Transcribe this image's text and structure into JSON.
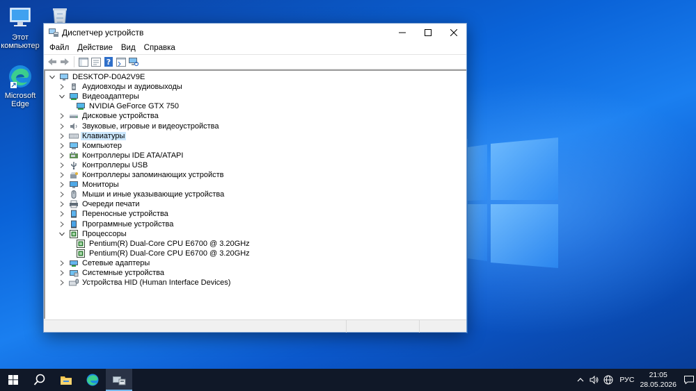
{
  "desktop": {
    "icons": [
      {
        "name": "this-pc",
        "label": "Этот компьютер"
      },
      {
        "name": "recycle-bin",
        "label": ""
      },
      {
        "name": "microsoft-edge",
        "label": "Microsoft Edge"
      }
    ]
  },
  "window": {
    "title": "Диспетчер устройств",
    "menu": [
      "Файл",
      "Действие",
      "Вид",
      "Справка"
    ],
    "toolbar_icons": [
      "back-arrow-icon",
      "forward-arrow-icon",
      "show-hide-console-tree-icon",
      "properties-icon",
      "help-icon",
      "action-pane-icon",
      "scan-hardware-icon"
    ],
    "tree": {
      "root": "DESKTOP-D0A2V9E",
      "items": [
        {
          "label": "Аудиовходы и аудиовыходы",
          "icon": "speaker-icon",
          "expanded": false
        },
        {
          "label": "Видеоадаптеры",
          "icon": "display-adapter-icon",
          "expanded": true,
          "children": [
            {
              "label": "NVIDIA GeForce GTX 750",
              "icon": "display-adapter-icon"
            }
          ]
        },
        {
          "label": "Дисковые устройства",
          "icon": "disk-drive-icon",
          "expanded": false
        },
        {
          "label": "Звуковые, игровые и видеоустройства",
          "icon": "sound-icon",
          "expanded": false
        },
        {
          "label": "Клавиатуры",
          "icon": "keyboard-icon",
          "expanded": false,
          "selected": true
        },
        {
          "label": "Компьютер",
          "icon": "computer-icon",
          "expanded": false
        },
        {
          "label": "Контроллеры IDE ATA/ATAPI",
          "icon": "ide-controller-icon",
          "expanded": false
        },
        {
          "label": "Контроллеры USB",
          "icon": "usb-icon",
          "expanded": false
        },
        {
          "label": "Контроллеры запоминающих устройств",
          "icon": "storage-controller-icon",
          "expanded": false
        },
        {
          "label": "Мониторы",
          "icon": "monitor-icon",
          "expanded": false
        },
        {
          "label": "Мыши и иные указывающие устройства",
          "icon": "mouse-icon",
          "expanded": false
        },
        {
          "label": "Очереди печати",
          "icon": "printer-icon",
          "expanded": false
        },
        {
          "label": "Переносные устройства",
          "icon": "portable-device-icon",
          "expanded": false
        },
        {
          "label": "Программные устройства",
          "icon": "software-device-icon",
          "expanded": false
        },
        {
          "label": "Процессоры",
          "icon": "processor-icon",
          "expanded": true,
          "children": [
            {
              "label": "Pentium(R) Dual-Core  CPU      E6700  @ 3.20GHz",
              "icon": "processor-icon"
            },
            {
              "label": "Pentium(R) Dual-Core  CPU      E6700  @ 3.20GHz",
              "icon": "processor-icon"
            }
          ]
        },
        {
          "label": "Сетевые адаптеры",
          "icon": "network-adapter-icon",
          "expanded": false
        },
        {
          "label": "Системные устройства",
          "icon": "system-device-icon",
          "expanded": false
        },
        {
          "label": "Устройства HID (Human Interface Devices)",
          "icon": "hid-icon",
          "expanded": false
        }
      ]
    }
  },
  "taskbar": {
    "apps": [
      "start-icon",
      "search-icon",
      "file-explorer-icon",
      "edge-icon",
      "device-manager-icon"
    ],
    "tray": {
      "language": "РУС",
      "time": "21:05",
      "date": "28.05.2026"
    }
  },
  "colors": {
    "selection": "#cce8ff",
    "taskbar": "#101828",
    "accent": "#0a63d8"
  }
}
